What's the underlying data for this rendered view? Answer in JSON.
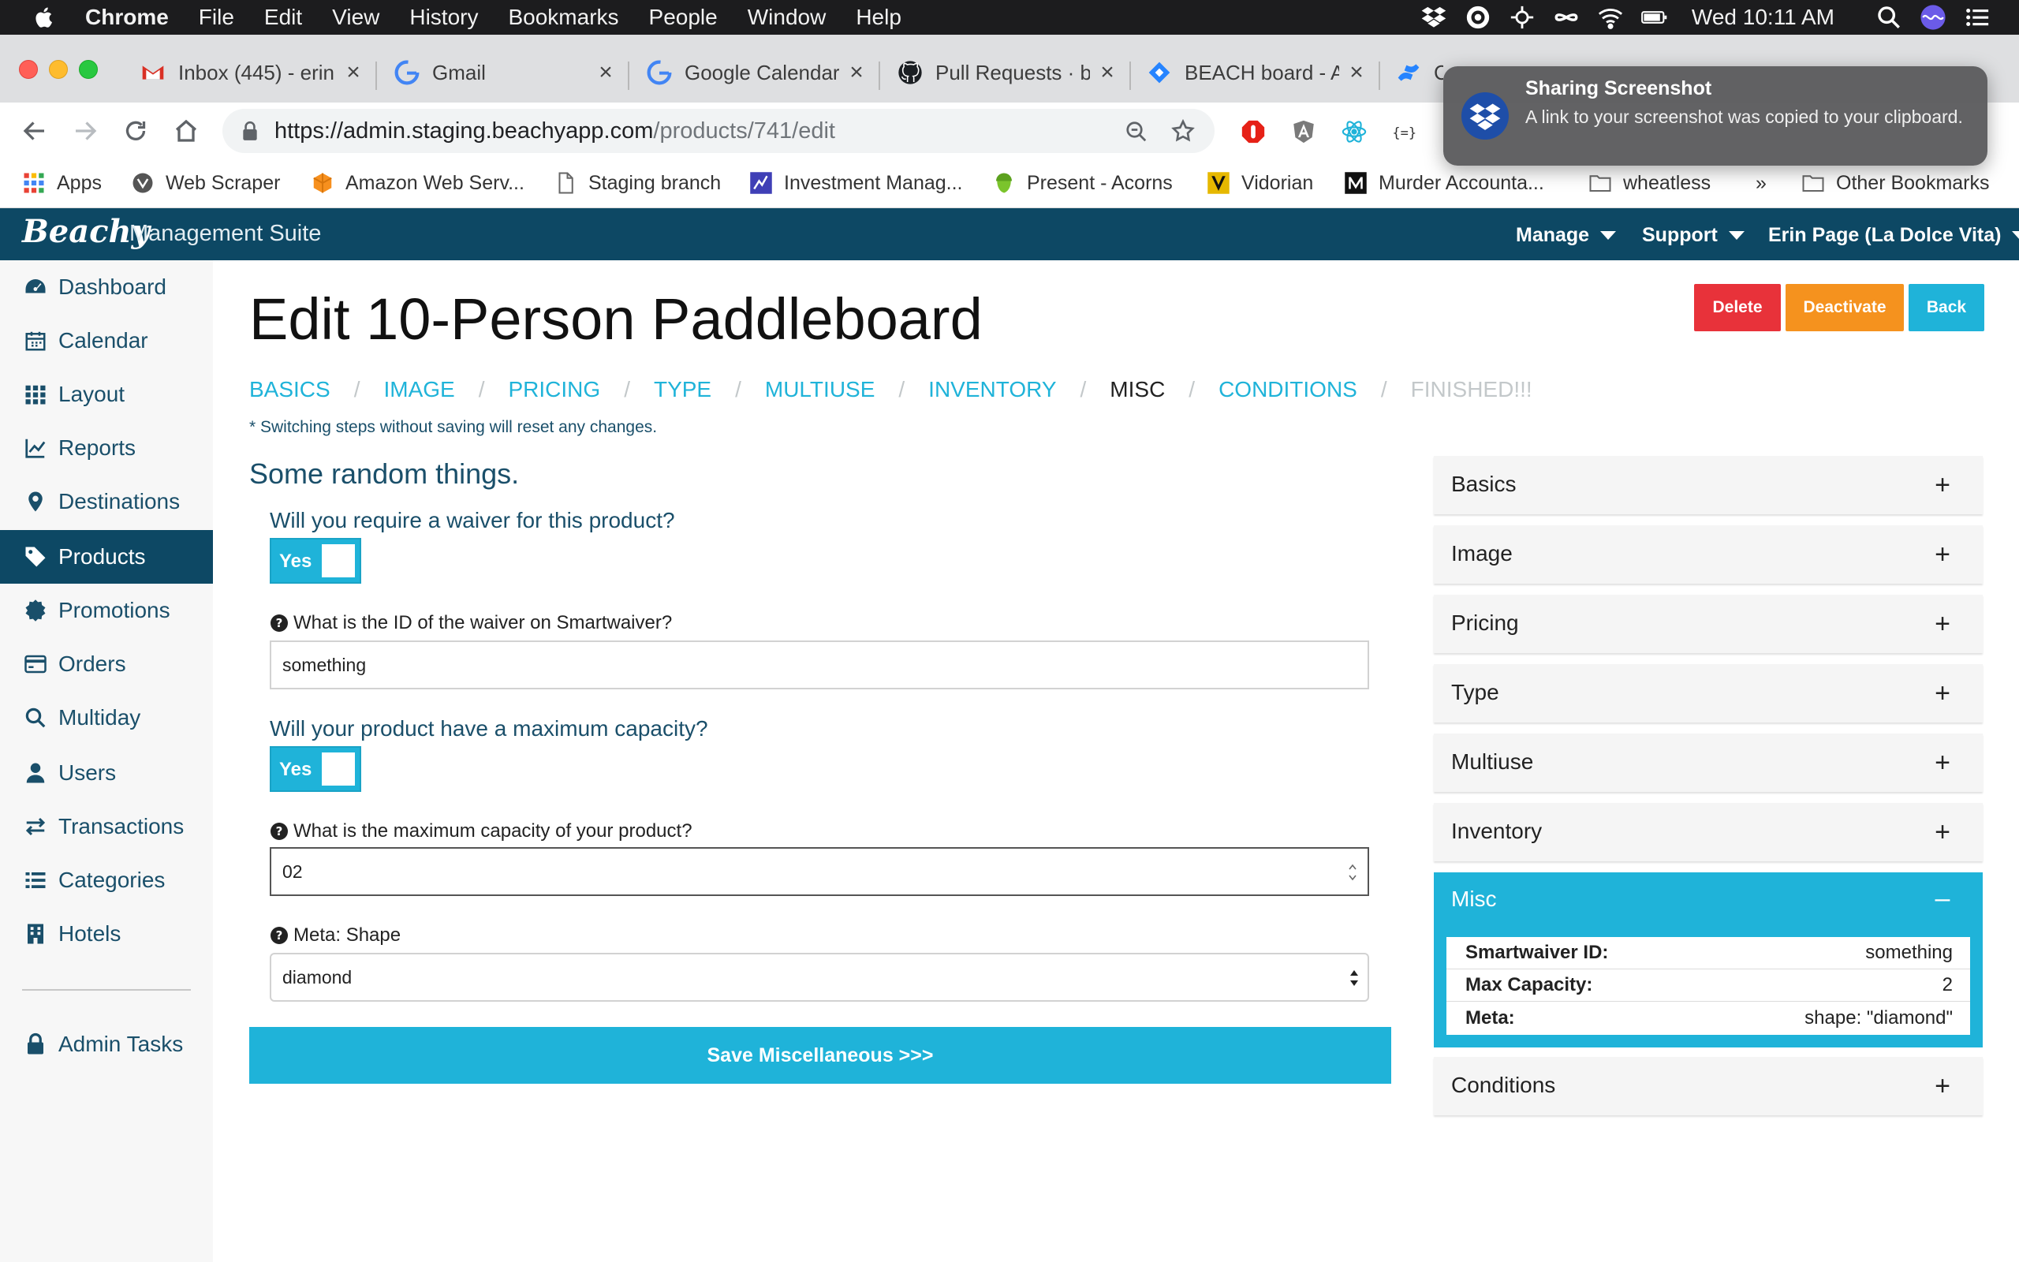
{
  "mac_menubar": {
    "app_name": "Chrome",
    "menus": [
      "File",
      "Edit",
      "View",
      "History",
      "Bookmarks",
      "People",
      "Window",
      "Help"
    ],
    "clock": "Wed 10:11 AM",
    "status_icons": [
      "dropbox-icon",
      "gauge-icon",
      "drone-icon",
      "infinity-icon",
      "wifi-icon",
      "battery-icon",
      "search-icon",
      "siri-icon",
      "control-center-icon"
    ]
  },
  "browser": {
    "tabs": [
      {
        "label": "Inbox (445) - erin",
        "icon": "gmail-icon",
        "close": "×"
      },
      {
        "label": "Gmail",
        "icon": "google-icon",
        "close": "×"
      },
      {
        "label": "Google Calendar",
        "icon": "google-icon",
        "close": "×"
      },
      {
        "label": "Pull Requests · b",
        "icon": "github-icon",
        "close": "×"
      },
      {
        "label": "BEACH board - A",
        "icon": "jira-icon",
        "close": "×"
      },
      {
        "label": "C",
        "icon": "confluence-icon",
        "close": ""
      }
    ],
    "url_host": "https://admin.staging.beachyapp.com",
    "url_path": "/products/741/edit",
    "bookmarks": [
      {
        "label": "Apps",
        "icon": "apps-grid-icon"
      },
      {
        "label": "Web Scraper",
        "icon": "web-scraper-icon"
      },
      {
        "label": "Amazon Web Serv...",
        "icon": "aws-icon"
      },
      {
        "label": "Staging branch",
        "icon": "page-icon"
      },
      {
        "label": "Investment Manag...",
        "icon": "investment-icon"
      },
      {
        "label": "Present - Acorns",
        "icon": "acorns-icon"
      },
      {
        "label": "Vidorian",
        "icon": "vidorian-icon"
      },
      {
        "label": "Murder Accounta...",
        "icon": "medium-icon"
      },
      {
        "label": "wheatless",
        "icon": "folder-icon"
      },
      {
        "label": "»",
        "icon": ""
      },
      {
        "label": "Other Bookmarks",
        "icon": "folder-icon"
      }
    ]
  },
  "notification": {
    "title": "Sharing Screenshot",
    "body": "A link to your screenshot was copied to your clipboard."
  },
  "app": {
    "logo": "Beachy",
    "suite": "Management Suite",
    "menus": [
      "Manage",
      "Support",
      "Erin Page (La Dolce Vita)"
    ]
  },
  "sidebar": {
    "items": [
      {
        "label": "Dashboard",
        "icon": "dashboard-icon"
      },
      {
        "label": "Calendar",
        "icon": "calendar-icon"
      },
      {
        "label": "Layout",
        "icon": "grid-icon"
      },
      {
        "label": "Reports",
        "icon": "chart-line-icon"
      },
      {
        "label": "Destinations",
        "icon": "map-marker-icon"
      },
      {
        "label": "Products",
        "icon": "tag-icon",
        "active": true
      },
      {
        "label": "Promotions",
        "icon": "certificate-icon"
      },
      {
        "label": "Orders",
        "icon": "credit-card-icon"
      },
      {
        "label": "Multiday",
        "icon": "search-icon"
      },
      {
        "label": "Users",
        "icon": "user-icon"
      },
      {
        "label": "Transactions",
        "icon": "exchange-icon"
      },
      {
        "label": "Categories",
        "icon": "list-icon"
      },
      {
        "label": "Hotels",
        "icon": "building-icon"
      }
    ],
    "admin": {
      "label": "Admin Tasks",
      "icon": "lock-icon"
    }
  },
  "page": {
    "title": "Edit 10-Person Paddleboard",
    "buttons": {
      "delete": "Delete",
      "deactivate": "Deactivate",
      "back": "Back"
    },
    "steps": [
      {
        "label": "BASICS",
        "state": "link"
      },
      {
        "label": "IMAGE",
        "state": "link"
      },
      {
        "label": "PRICING",
        "state": "link"
      },
      {
        "label": "TYPE",
        "state": "link"
      },
      {
        "label": "MULTIUSE",
        "state": "link"
      },
      {
        "label": "INVENTORY",
        "state": "link"
      },
      {
        "label": "MISC",
        "state": "current"
      },
      {
        "label": "CONDITIONS",
        "state": "link"
      },
      {
        "label": "FINISHED!!!",
        "state": "disabled"
      }
    ],
    "step_separator": "/",
    "step_note": "* Switching steps without saving will reset any changes.",
    "section_heading": "Some random things.",
    "waiver_question": "Will you require a waiver for this product?",
    "waiver_toggle": "Yes",
    "waiver_id_label": "What is the ID of the waiver on Smartwaiver?",
    "waiver_id_value": "something",
    "capacity_question": "Will your product have a maximum capacity?",
    "capacity_toggle": "Yes",
    "capacity_label": "What is the maximum capacity of your product?",
    "capacity_value": "02",
    "meta_label": "Meta: Shape",
    "meta_value": "diamond",
    "save_button": "Save Miscellaneous >>>"
  },
  "accordion": {
    "sections": [
      "Basics",
      "Image",
      "Pricing",
      "Type",
      "Multiuse",
      "Inventory"
    ],
    "expand_symbol": "+",
    "collapse_symbol": "–",
    "open": {
      "title": "Misc",
      "rows": [
        {
          "key": "Smartwaiver ID:",
          "value": "something"
        },
        {
          "key": "Max Capacity:",
          "value": "2"
        },
        {
          "key": "Meta:",
          "value": "shape: \"diamond\""
        }
      ]
    },
    "after": [
      "Conditions"
    ]
  },
  "colors": {
    "brand_navy": "#0d4864",
    "accent_cyan": "#1fb3d9",
    "delete_red": "#e8323a",
    "deactivate_orange": "#f5921e"
  }
}
